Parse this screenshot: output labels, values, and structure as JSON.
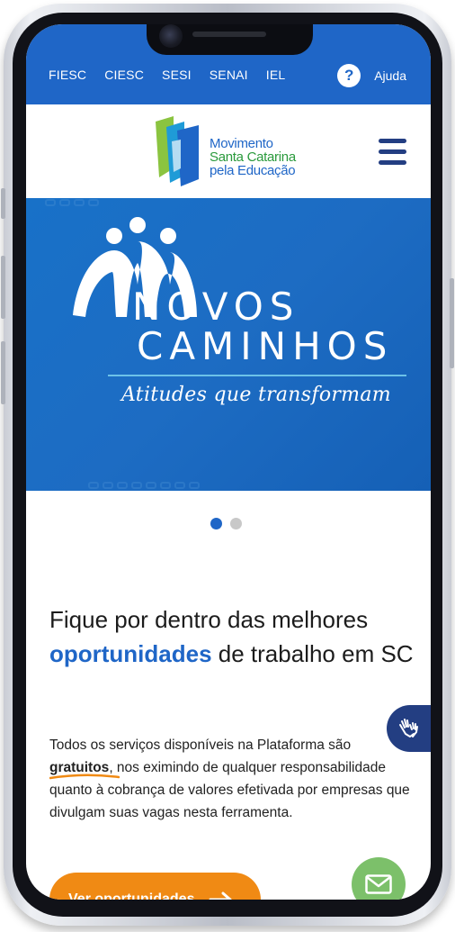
{
  "topbar": {
    "links": [
      "FIESC",
      "CIESC",
      "SESI",
      "SENAI",
      "IEL"
    ],
    "help_icon": "question-circle-icon",
    "help_label": "Ajuda",
    "color": "#1f66c7"
  },
  "header": {
    "logo_lines": [
      "Movimento",
      "Santa Catarina",
      "pela Educação"
    ],
    "menu_icon": "hamburger-menu-icon"
  },
  "banner": {
    "title_line1": "NOVOS",
    "title_line2": "CAMINHOS",
    "subtitle": "Atitudes que transformam",
    "background": "#1871c8"
  },
  "carousel": {
    "slides": 2,
    "active": 1
  },
  "content": {
    "headline_before": "Fique por dentro das melhores ",
    "headline_accent": "oportunidades",
    "headline_after": " de trabalho em SC",
    "paragraph_before": "Todos os serviços disponíveis na Plataforma são ",
    "paragraph_bold": "gratuitos",
    "paragraph_after": ", nos eximindo de qualquer responsabilidade quanto à cobrança de valores efetivada por empresas que divulgam suas vagas nesta ferramenta."
  },
  "cta": {
    "label": "Ver oportunidades",
    "arrow_icon": "arrow-right-icon",
    "color": "#f08a14"
  },
  "floating": {
    "accessibility_icon": "sign-language-hands-icon",
    "mail_icon": "envelope-icon",
    "mail_color": "#7cc06a"
  }
}
